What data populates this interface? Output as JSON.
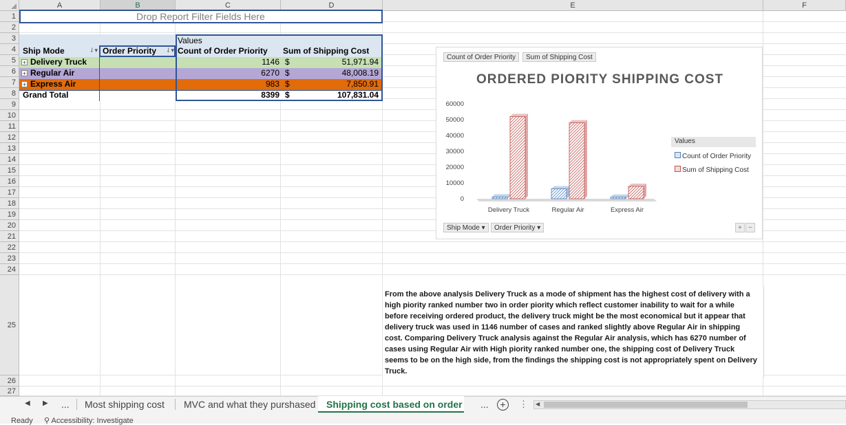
{
  "sheet": {
    "columns": [
      "A",
      "B",
      "C",
      "D",
      "E",
      "F"
    ],
    "rows": [
      "1",
      "2",
      "3",
      "4",
      "5",
      "6",
      "7",
      "8",
      "9",
      "10",
      "11",
      "12",
      "13",
      "14",
      "15",
      "16",
      "17",
      "18",
      "19",
      "20",
      "21",
      "22",
      "23",
      "24",
      "25",
      "26",
      "27"
    ],
    "drop_filter_text": "Drop Report Filter Fields Here"
  },
  "pivot": {
    "values_label": "Values",
    "headers": {
      "ship_mode": "Ship Mode",
      "order_priority": "Order Priority",
      "count": "Count of Order Priority",
      "cost": "Sum of Shipping Cost"
    },
    "rows": [
      {
        "label": "Delivery Truck",
        "count": "1146",
        "currency": "$",
        "cost": "51,971.94",
        "color": "#c6e0b4"
      },
      {
        "label": "Regular Air",
        "count": "6270",
        "currency": "$",
        "cost": "48,008.19",
        "color": "#b4a7d6"
      },
      {
        "label": "Express Air",
        "count": "983",
        "currency": "$",
        "cost": "7,850.91",
        "color": "#e26b0a"
      }
    ],
    "grand_total": {
      "label": "Grand Total",
      "count": "8399",
      "currency": "$",
      "cost": "107,831.04"
    }
  },
  "chart": {
    "value_buttons": [
      "Count of Order Priority",
      "Sum of Shipping Cost"
    ],
    "axis_buttons": [
      "Ship Mode",
      "Order Priority"
    ],
    "plus": "+",
    "minus": "−",
    "legend_title": "Values"
  },
  "chart_data": {
    "type": "bar",
    "title": "ORDERED PIORITY SHIPPING COST",
    "categories": [
      "Delivery Truck",
      "Regular Air",
      "Express Air"
    ],
    "series": [
      {
        "name": "Count of Order Priority",
        "values": [
          1146,
          6270,
          983
        ],
        "color": "#4f81bd"
      },
      {
        "name": "Sum of Shipping Cost",
        "values": [
          51971.94,
          48008.19,
          7850.91
        ],
        "color": "#c0504d"
      }
    ],
    "yticks": [
      "60000",
      "50000",
      "40000",
      "30000",
      "20000",
      "10000",
      "0"
    ],
    "ylim": [
      0,
      60000
    ]
  },
  "analysis_text": "From the above analysis Delivery Truck as a mode of shipment has the highest cost of delivery with a high piority ranked number two in order piority which reflect customer inability to wait for a while before receiving ordered product, the delivery truck might be the most economical but it appear that delivery truck was used in 1146 number of cases and ranked slightly above Regular Air in shipping cost. Comparing  Delivery Truck analysis against the Regular Air analysis, which has  6270 number of cases using Regular Air with High piority ranked number one, the shipping cost of Delivery Truck seems to be on the high side, from the findings the shipping cost is not appropriately spent on Delivery Truck.",
  "tabs": {
    "ellipsis": "...",
    "items": [
      "Most shipping cost",
      "MVC and what they purshased",
      "Shipping cost based on order"
    ],
    "active_color": "#217346"
  },
  "status": {
    "ready": "Ready",
    "accessibility": "Accessibility: Investigate"
  }
}
